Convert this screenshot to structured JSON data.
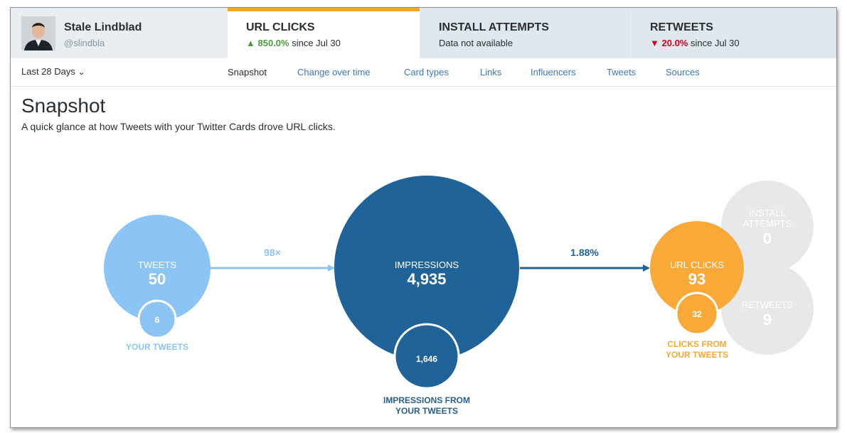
{
  "profile": {
    "name": "Stale Lindblad",
    "handle": "@slindbla"
  },
  "tabs": [
    {
      "title": "URL CLICKS",
      "arrow": "▲",
      "change": "850.0%",
      "since": " since Jul 30"
    },
    {
      "title": "INSTALL ATTEMPTS",
      "status": "Data not available"
    },
    {
      "title": "RETWEETS",
      "arrow": "▼",
      "change": "20.0%",
      "since": " since Jul 30"
    }
  ],
  "date_range": {
    "label": "Last 28 Days"
  },
  "nav": [
    "Snapshot",
    "Change over time",
    "Card types",
    "Links",
    "Influencers",
    "Tweets",
    "Sources"
  ],
  "page": {
    "title": "Snapshot",
    "description": "A quick glance at how Tweets with your Twitter Cards drove URL clicks."
  },
  "viz": {
    "tweets": {
      "label": "TWEETS",
      "value": "50",
      "sub_value": "6",
      "sub_label": "YOUR TWEETS"
    },
    "multiplier": "98×",
    "impressions": {
      "label": "IMPRESSIONS",
      "value": "4,935",
      "sub_value": "1,646",
      "sub_label_1": "IMPRESSIONS FROM",
      "sub_label_2": "YOUR TWEETS"
    },
    "rate": "1.88%",
    "url_clicks": {
      "label": "URL CLICKS",
      "value": "93",
      "sub_value": "32",
      "sub_label_1": "CLICKS FROM",
      "sub_label_2": "YOUR TWEETS"
    },
    "install": {
      "label_1": "INSTALL",
      "label_2": "ATTEMPTS",
      "value": "0"
    },
    "retweets": {
      "label": "RETWEETS",
      "value": "9"
    }
  },
  "colors": {
    "light_blue": "#8bc4f5",
    "dark_blue": "#1f6398",
    "orange": "#f8a938",
    "grey": "#e6e8ea",
    "accent_bar": "#f5a623"
  }
}
